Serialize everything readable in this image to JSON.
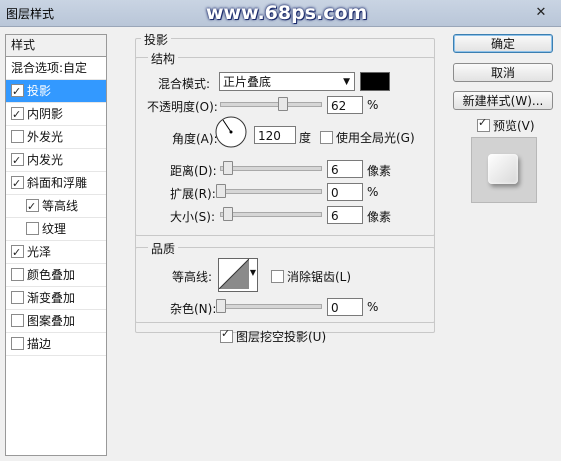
{
  "window": {
    "title": "图层样式",
    "watermark": "www.68ps.com",
    "close": "✕"
  },
  "stylelist": {
    "header": "样式",
    "blend_options": "混合选项:自定",
    "items": [
      {
        "label": "投影",
        "checked": true,
        "selected": true,
        "sub": false
      },
      {
        "label": "内阴影",
        "checked": true,
        "selected": false,
        "sub": false
      },
      {
        "label": "外发光",
        "checked": false,
        "selected": false,
        "sub": false
      },
      {
        "label": "内发光",
        "checked": true,
        "selected": false,
        "sub": false
      },
      {
        "label": "斜面和浮雕",
        "checked": true,
        "selected": false,
        "sub": false
      },
      {
        "label": "等高线",
        "checked": true,
        "selected": false,
        "sub": true
      },
      {
        "label": "纹理",
        "checked": false,
        "selected": false,
        "sub": true
      },
      {
        "label": "光泽",
        "checked": true,
        "selected": false,
        "sub": false
      },
      {
        "label": "颜色叠加",
        "checked": false,
        "selected": false,
        "sub": false
      },
      {
        "label": "渐变叠加",
        "checked": false,
        "selected": false,
        "sub": false
      },
      {
        "label": "图案叠加",
        "checked": false,
        "selected": false,
        "sub": false
      },
      {
        "label": "描边",
        "checked": false,
        "selected": false,
        "sub": false
      }
    ]
  },
  "shadow": {
    "section_title": "投影",
    "structure_title": "结构",
    "blend_mode_label": "混合模式:",
    "blend_mode_value": "正片叠底",
    "opacity_label": "不透明度(O):",
    "opacity_value": "62",
    "opacity_unit": "%",
    "angle_label": "角度(A):",
    "angle_value": "120",
    "angle_unit": "度",
    "global_light_label": "使用全局光(G)",
    "distance_label": "距离(D):",
    "distance_value": "6",
    "distance_unit": "像素",
    "spread_label": "扩展(R):",
    "spread_value": "0",
    "spread_unit": "%",
    "size_label": "大小(S):",
    "size_value": "6",
    "size_unit": "像素",
    "quality_title": "品质",
    "contour_label": "等高线:",
    "antialias_label": "消除锯齿(L)",
    "noise_label": "杂色(N):",
    "noise_value": "0",
    "noise_unit": "%",
    "knockout_label": "图层挖空投影(U)"
  },
  "buttons": {
    "ok": "确定",
    "cancel": "取消",
    "new_style": "新建样式(W)...",
    "preview": "预览(V)"
  },
  "colors": {
    "shadow_color": "#000000",
    "selection": "#3399ff"
  }
}
